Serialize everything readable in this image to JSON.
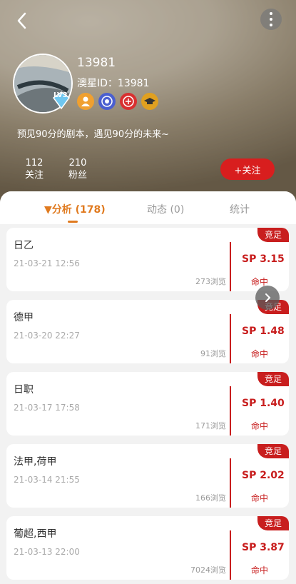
{
  "profile": {
    "name": "13981",
    "uid": "澳星ID：13981",
    "level": "LV3",
    "bio": "预见90分的剧本，遇见90分的未来~",
    "following_count": "112",
    "following_label": "关注",
    "fans_count": "210",
    "fans_label": "粉丝",
    "follow_button": "+关注",
    "badges": [
      "user-badge-icon",
      "emblem-blue-icon",
      "emblem-red-icon",
      "graduation-cap-icon"
    ]
  },
  "tabs": [
    {
      "label": "▼分析 (178)",
      "active": true
    },
    {
      "label": "动态 (0)",
      "active": false
    },
    {
      "label": "统计",
      "active": false
    }
  ],
  "posts": [
    {
      "title": "日乙",
      "time": "21-03-21 12:56",
      "views": "273浏览",
      "sp": "SP 3.15",
      "result": "命中",
      "tag": "竞足"
    },
    {
      "title": "德甲",
      "time": "21-03-20 22:27",
      "views": "91浏览",
      "sp": "SP 1.48",
      "result": "命中",
      "tag": "竞足"
    },
    {
      "title": "日职",
      "time": "21-03-17 17:58",
      "views": "171浏览",
      "sp": "SP 1.40",
      "result": "命中",
      "tag": "竞足"
    },
    {
      "title": "法甲,荷甲",
      "time": "21-03-14 21:55",
      "views": "166浏览",
      "sp": "SP 2.02",
      "result": "命中",
      "tag": "竞足"
    },
    {
      "title": "葡超,西甲",
      "time": "21-03-13 22:00",
      "views": "7024浏览",
      "sp": "SP 3.87",
      "result": "命中",
      "tag": "竞足"
    }
  ],
  "colors": {
    "accent": "#d81e1e",
    "tab_active": "#e07a1f"
  }
}
